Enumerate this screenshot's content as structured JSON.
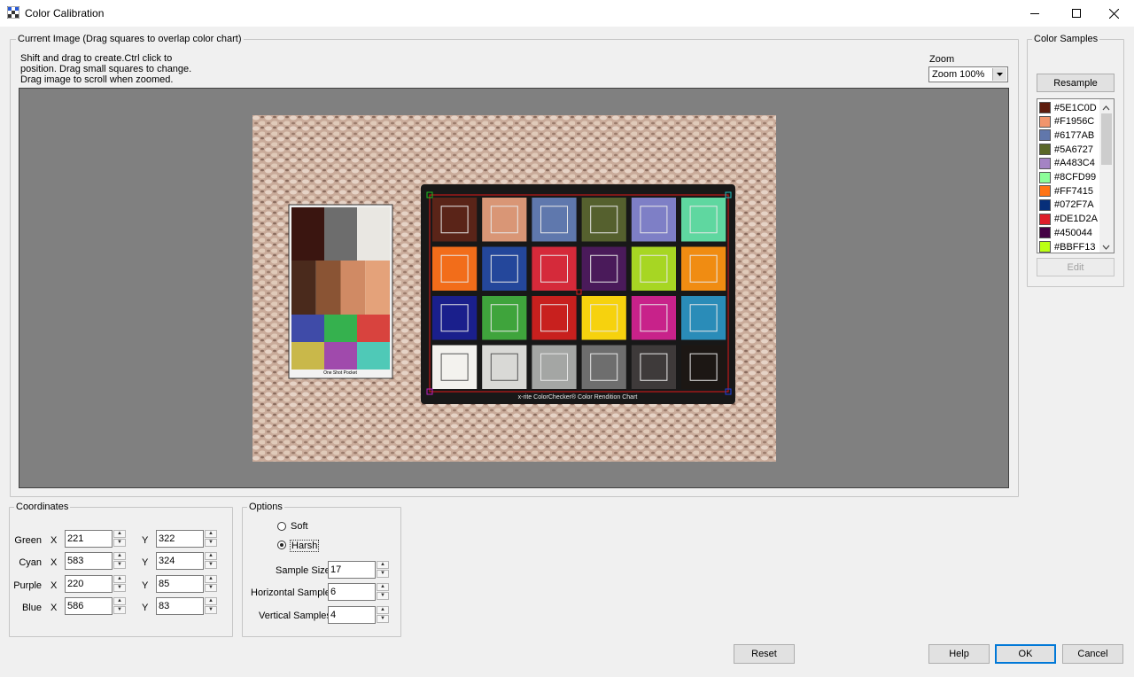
{
  "window": {
    "title": "Color Calibration"
  },
  "current_image": {
    "legend": "Current Image (Drag squares to overlap color chart)",
    "instructions": [
      "Shift and drag to create.Ctrl click to",
      "position. Drag small squares to change.",
      "Drag image to scroll when zoomed."
    ],
    "zoom_label": "Zoom",
    "zoom_value": "Zoom 100%",
    "chart_caption": "x-rite ColorChecker® Color Rendition Chart",
    "mini_chart_caption": "One Shot     Pocket"
  },
  "color_samples": {
    "legend": "Color Samples",
    "resample_label": "Resample",
    "edit_label": "Edit",
    "samples": [
      {
        "hex": "#5E1C0D",
        "color": "#5E1C0D"
      },
      {
        "hex": "#F1956C",
        "color": "#F1956C"
      },
      {
        "hex": "#6177AB",
        "color": "#6177AB"
      },
      {
        "hex": "#5A6727",
        "color": "#5A6727"
      },
      {
        "hex": "#A483C4",
        "color": "#A483C4"
      },
      {
        "hex": "#8CFD99",
        "color": "#8CFD99"
      },
      {
        "hex": "#FF7415",
        "color": "#FF7415"
      },
      {
        "hex": "#072F7A",
        "color": "#072F7A"
      },
      {
        "hex": "#DE1D2A",
        "color": "#DE1D2A"
      },
      {
        "hex": "#450044",
        "color": "#450044"
      },
      {
        "hex": "#BBFF13",
        "color": "#BBFF13"
      }
    ]
  },
  "coordinates": {
    "legend": "Coordinates",
    "x_label": "X",
    "y_label": "Y",
    "rows": [
      {
        "label": "Green",
        "x": "221",
        "y": "322"
      },
      {
        "label": "Cyan",
        "x": "583",
        "y": "324"
      },
      {
        "label": "Purple",
        "x": "220",
        "y": "85"
      },
      {
        "label": "Blue",
        "x": "586",
        "y": "83"
      }
    ]
  },
  "options": {
    "legend": "Options",
    "soft_label": "Soft",
    "harsh_label": "Harsh",
    "selected": "Harsh",
    "sample_size_label": "Sample Size",
    "sample_size": "17",
    "horizontal_samples_label": "Horizontal Samples",
    "horizontal_samples": "6",
    "vertical_samples_label": "Vertical Samples",
    "vertical_samples": "4"
  },
  "footer": {
    "reset_label": "Reset",
    "help_label": "Help",
    "ok_label": "OK",
    "cancel_label": "Cancel"
  },
  "checker_colors": [
    "#5a2418",
    "#d99676",
    "#5f78ad",
    "#55602e",
    "#7e7fc6",
    "#5fd7a0",
    "#f26d1a",
    "#24479b",
    "#d52a3a",
    "#4a1a5a",
    "#a7d623",
    "#f08c12",
    "#1a1f8c",
    "#3fa43c",
    "#c8201e",
    "#f6d20e",
    "#c8228a",
    "#2a8cb8",
    "#f3f2ee",
    "#d9d9d6",
    "#a4a6a4",
    "#6e6e6e",
    "#3e3a3a",
    "#1c1714"
  ],
  "mini_colors": [
    "#3a1510",
    "#6d6d6d",
    "#e9e7e2",
    "#4a2a1c",
    "#8a5434",
    "#d08a64",
    "#e4a27a",
    "#3f4ba8",
    "#35b14e",
    "#d8433e",
    "#c9b84a",
    "#a04aac",
    "#4fc9b7"
  ],
  "icons": {
    "app": "checker-icon",
    "minimize": "minimize-icon",
    "maximize": "maximize-icon",
    "close": "close-icon",
    "dropdown": "chevron-down-icon"
  }
}
